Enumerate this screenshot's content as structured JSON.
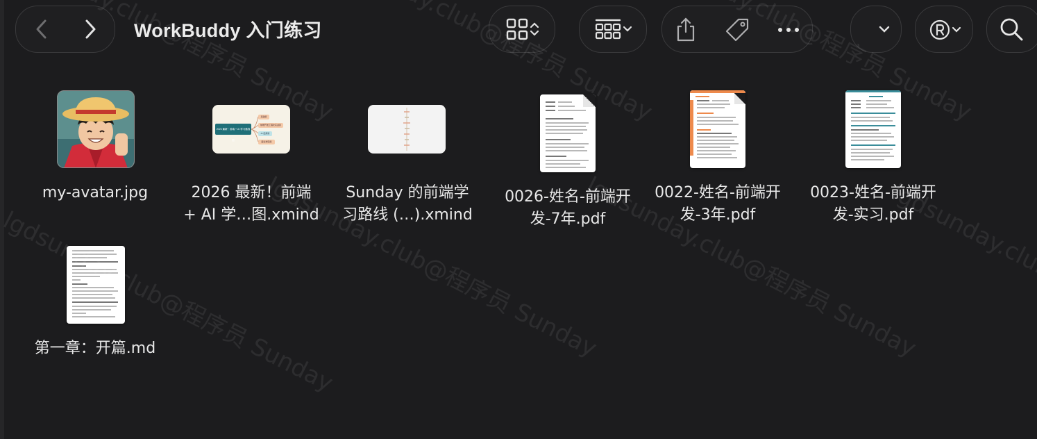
{
  "window": {
    "title": "WorkBuddy 入门练习"
  },
  "toolbar": {
    "back_icon": "chevron-left-icon",
    "forward_icon": "chevron-right-icon",
    "view_icon": "grid-view-icon",
    "group_icon": "group-by-icon",
    "share_icon": "share-icon",
    "tag_icon": "tag-icon",
    "more_icon": "ellipsis-icon",
    "dropdown_icon": "chevron-down-icon",
    "registered_icon": "registered-icon",
    "search_icon": "search-icon"
  },
  "files": [
    {
      "name": "my-avatar.jpg",
      "lines": [
        "my-avatar.jpg"
      ],
      "kind": "image"
    },
    {
      "name": "2026 最新！前端 + AI 学…图.xmind",
      "lines": [
        "2026 最新！前端",
        "+ AI 学…图.xmind"
      ],
      "kind": "xmind-color"
    },
    {
      "name": "Sunday 的前端学习路线 (…).xmind",
      "lines": [
        "Sunday 的前端学",
        "习路线 (…).xmind"
      ],
      "kind": "xmind-plain"
    },
    {
      "name": "0026-姓名-前端开发-7年.pdf",
      "lines": [
        "0026-姓名-前端开",
        "发-7年.pdf"
      ],
      "kind": "pdf"
    },
    {
      "name": "0022-姓名-前端开发-3年.pdf",
      "lines": [
        "0022-姓名-前端开",
        "发-3年.pdf"
      ],
      "kind": "pdf-orange"
    },
    {
      "name": "0023-姓名-前端开发-实习.pdf",
      "lines": [
        "0023-姓名-前端开",
        "发-实习.pdf"
      ],
      "kind": "pdf-teal"
    },
    {
      "name": "第一章：开篇.md",
      "lines": [
        "第一章：开篇.md"
      ],
      "kind": "md"
    }
  ],
  "mindmap": {
    "center": "2026 最新！前端 + AI 学习路线图",
    "nodes": [
      "基础篇",
      "前端开发工程化实战篇",
      "AI 应用篇",
      "面试求职篇"
    ]
  },
  "watermark": {
    "text": "lgdsunday.club@程序员 Sunday"
  },
  "colors": {
    "background": "#1c1c1e",
    "teal": "#1f6f78",
    "orange": "#ee8a4c"
  }
}
